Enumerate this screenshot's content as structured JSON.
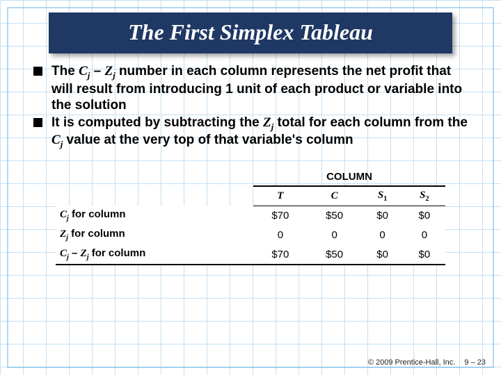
{
  "title": "The First Simplex Tableau",
  "bullets": {
    "b1_pre": "The ",
    "b1_cj": "C",
    "b1_j": "j",
    "b1_mid1": " – ",
    "b1_zj": "Z",
    "b1_j2": "j",
    "b1_post": " number in each column represents the net profit that will result from introducing 1 unit of each product or variable into the solution",
    "b2_pre": "It is computed by subtracting the ",
    "b2_zj": "Z",
    "b2_jz": "j",
    "b2_mid": " total for each column from the ",
    "b2_cj": "C",
    "b2_jc": "j",
    "b2_post": " value at the very top of that variable's column"
  },
  "table": {
    "overhead": "COLUMN",
    "headers": {
      "h1": "T",
      "h2": "C",
      "h3_s": "S",
      "h3_sub": "1",
      "h4_s": "S",
      "h4_sub": "2"
    },
    "rows": {
      "r1_label_c": "C",
      "r1_label_j": "j",
      "r1_label_rest": " for column",
      "r1_v1": "$70",
      "r1_v2": "$50",
      "r1_v3": "$0",
      "r1_v4": "$0",
      "r2_label_z": "Z",
      "r2_label_j": "j",
      "r2_label_rest": " for column",
      "r2_v1": "0",
      "r2_v2": "0",
      "r2_v3": "0",
      "r2_v4": "0",
      "r3_label_c": "C",
      "r3_label_jc": "j",
      "r3_label_mid": " – ",
      "r3_label_z": "Z",
      "r3_label_jz": "j",
      "r3_label_rest": " for column",
      "r3_v1": "$70",
      "r3_v2": "$50",
      "r3_v3": "$0",
      "r3_v4": "$0"
    }
  },
  "chart_data": {
    "type": "table",
    "title": "COLUMN",
    "columns": [
      "T",
      "C",
      "S1",
      "S2"
    ],
    "rows": [
      {
        "label": "Cj for column",
        "values": [
          "$70",
          "$50",
          "$0",
          "$0"
        ]
      },
      {
        "label": "Zj for column",
        "values": [
          "0",
          "0",
          "0",
          "0"
        ]
      },
      {
        "label": "Cj – Zj for column",
        "values": [
          "$70",
          "$50",
          "$0",
          "$0"
        ]
      }
    ]
  },
  "footer": {
    "copyright": "© 2009 Prentice-Hall, Inc.",
    "page": "9 – 23"
  }
}
